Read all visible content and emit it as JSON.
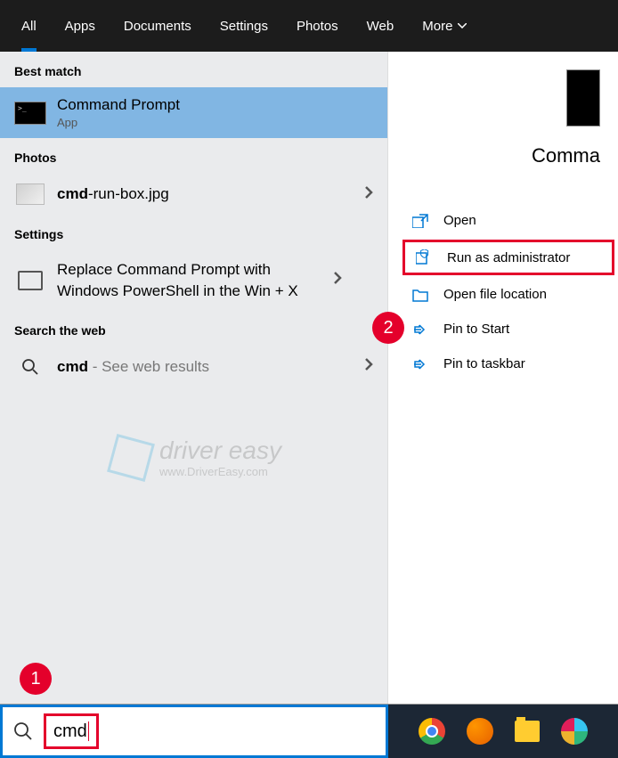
{
  "tabs": {
    "items": [
      "All",
      "Apps",
      "Documents",
      "Settings",
      "Photos",
      "Web",
      "More"
    ],
    "active": 0
  },
  "sections": {
    "best_match": "Best match",
    "photos": "Photos",
    "settings": "Settings",
    "web": "Search the web"
  },
  "results": {
    "cmd": {
      "title": "Command Prompt",
      "sub": "App"
    },
    "photo": {
      "bold": "cmd",
      "rest": "-run-box.jpg"
    },
    "setting": {
      "text": "Replace Command Prompt with Windows PowerShell in the Win + X"
    },
    "web": {
      "bold": "cmd",
      "rest": " - See web results"
    }
  },
  "preview": {
    "title": "Comma"
  },
  "actions": {
    "open": "Open",
    "run_admin": "Run as administrator",
    "open_loc": "Open file location",
    "pin_start": "Pin to Start",
    "pin_taskbar": "Pin to taskbar"
  },
  "callouts": {
    "one": "1",
    "two": "2"
  },
  "watermark": {
    "brand": "driver easy",
    "url": "www.DriverEasy.com"
  },
  "search": {
    "value": "cmd"
  }
}
